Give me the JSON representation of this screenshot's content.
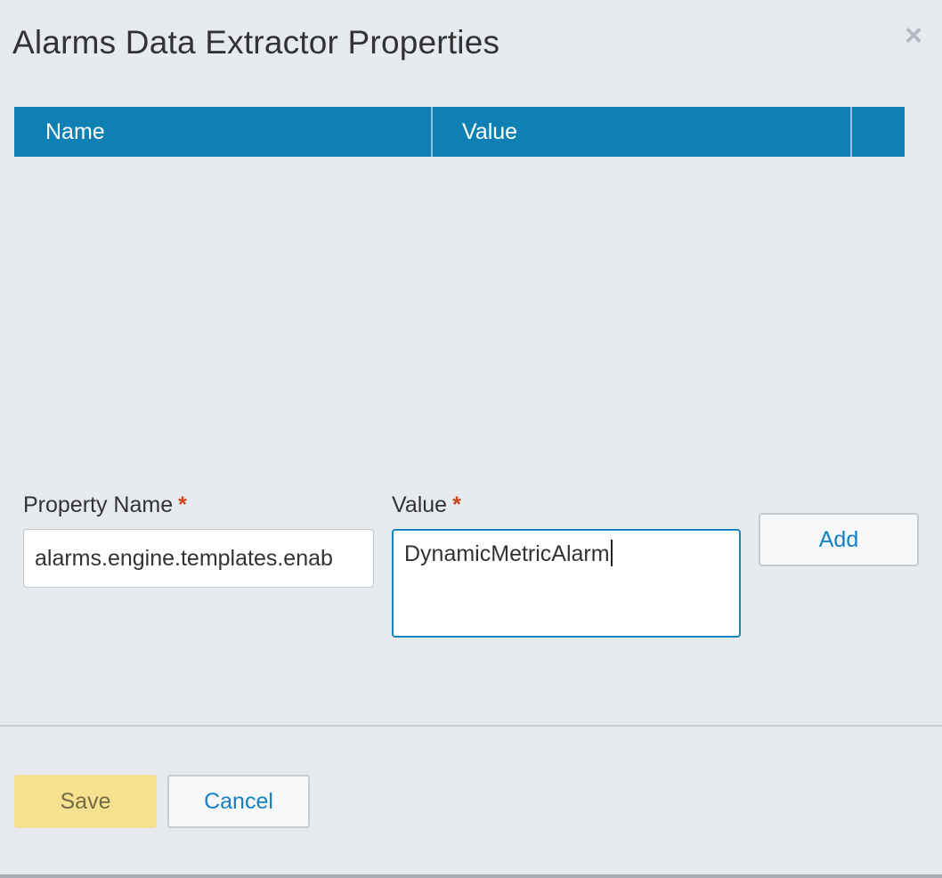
{
  "dialog": {
    "title": "Alarms Data Extractor Properties",
    "close_icon": "×"
  },
  "grid": {
    "columns": [
      "Name",
      "Value"
    ],
    "rows": []
  },
  "form": {
    "property_name_label": "Property Name",
    "value_label": "Value",
    "required_marker": "*",
    "property_name_value": "alarms.engine.templates.enab",
    "value_value": "DynamicMetricAlarm",
    "add_label": "Add"
  },
  "footer": {
    "save_label": "Save",
    "cancel_label": "Cancel"
  },
  "colors": {
    "header_bg": "#0e80b4",
    "primary_button_bg": "#f5e290",
    "link_blue": "#1581c0",
    "required_red": "#d0431a",
    "dialog_bg": "#e7ebf0"
  }
}
